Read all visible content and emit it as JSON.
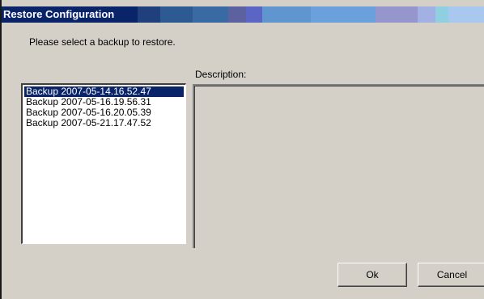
{
  "window": {
    "title": "Restore Configuration",
    "titlebar_colors": [
      "#0a246a",
      "#1f3f7d",
      "#2e5a93",
      "#3a6aa4",
      "#5c62a0",
      "#5a65c6",
      "#5f96d0",
      "#6aa0db",
      "#9597cc",
      "#a2b0e3",
      "#8fcfe0",
      "#a9c8f0"
    ]
  },
  "dialog": {
    "prompt": "Please select a backup to restore.",
    "description_label": "Description:",
    "description_text": "",
    "backups": [
      {
        "label": "Backup 2007-05-14.16.52.47",
        "selected": true
      },
      {
        "label": "Backup 2007-05-16.19.56.31",
        "selected": false
      },
      {
        "label": "Backup 2007-05-16.20.05.39",
        "selected": false
      },
      {
        "label": "Backup 2007-05-21.17.47.52",
        "selected": false
      }
    ]
  },
  "buttons": {
    "ok_label": "Ok",
    "cancel_label": "Cancel"
  }
}
